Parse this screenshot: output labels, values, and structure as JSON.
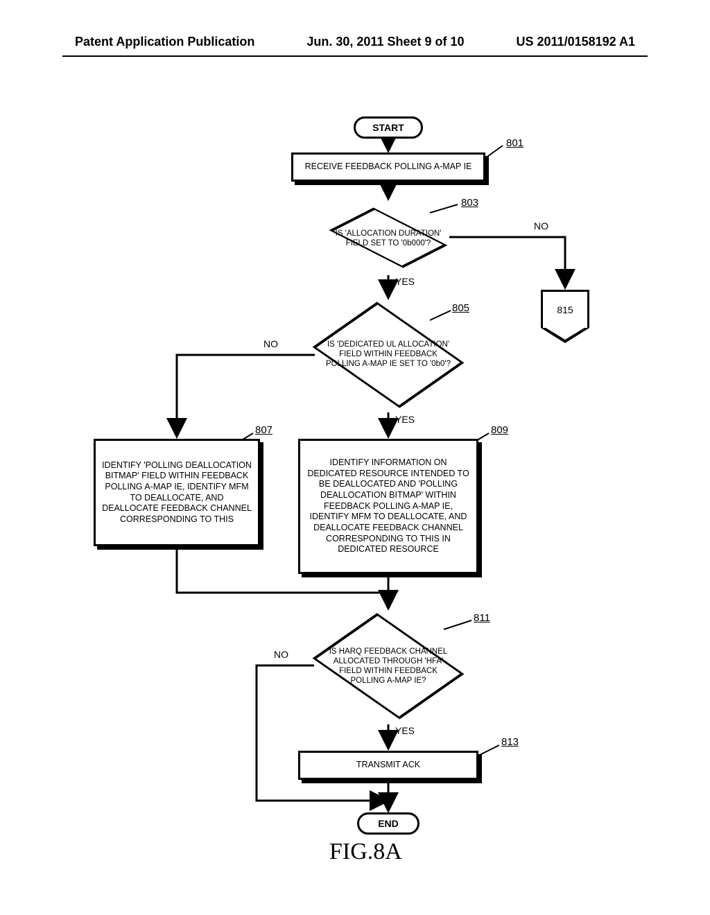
{
  "header": {
    "left": "Patent Application Publication",
    "center": "Jun. 30, 2011  Sheet 9 of 10",
    "right": "US 2011/0158192 A1"
  },
  "nodes": {
    "start": "START",
    "end": "END",
    "step801": "RECEIVE FEEDBACK POLLING A-MAP IE",
    "step807": "IDENTIFY 'POLLING DEALLOCATION BITMAP' FIELD WITHIN FEEDBACK POLLING A-MAP IE, IDENTIFY MFM TO DEALLOCATE, AND DEALLOCATE FEEDBACK CHANNEL CORRESPONDING TO THIS",
    "step809": "IDENTIFY INFORMATION ON DEDICATED RESOURCE INTENDED TO BE DEALLOCATED AND 'POLLING DEALLOCATION BITMAP' WITHIN FEEDBACK POLLING A-MAP IE, IDENTIFY MFM TO DEALLOCATE, AND DEALLOCATE FEEDBACK CHANNEL CORRESPONDING TO THIS IN DEDICATED RESOURCE",
    "step813": "TRANSMIT ACK",
    "dec803": "IS 'ALLOCATION DURATION' FIELD SET TO '0b000'?",
    "dec805": "IS 'DEDICATED UL ALLOCATION' FIELD WITHIN FEEDBACK POLLING A-MAP IE SET TO '0b0'?",
    "dec811": "IS HARQ FEEDBACK CHANNEL ALLOCATED THROUGH 'HFA' FIELD WITHIN FEEDBACK POLLING A-MAP IE?",
    "off815": "815"
  },
  "refs": {
    "r801": "801",
    "r803": "803",
    "r805": "805",
    "r807": "807",
    "r809": "809",
    "r811": "811",
    "r813": "813",
    "r815": "815"
  },
  "labels": {
    "yes": "YES",
    "no": "NO"
  },
  "caption": "FIG.8A"
}
